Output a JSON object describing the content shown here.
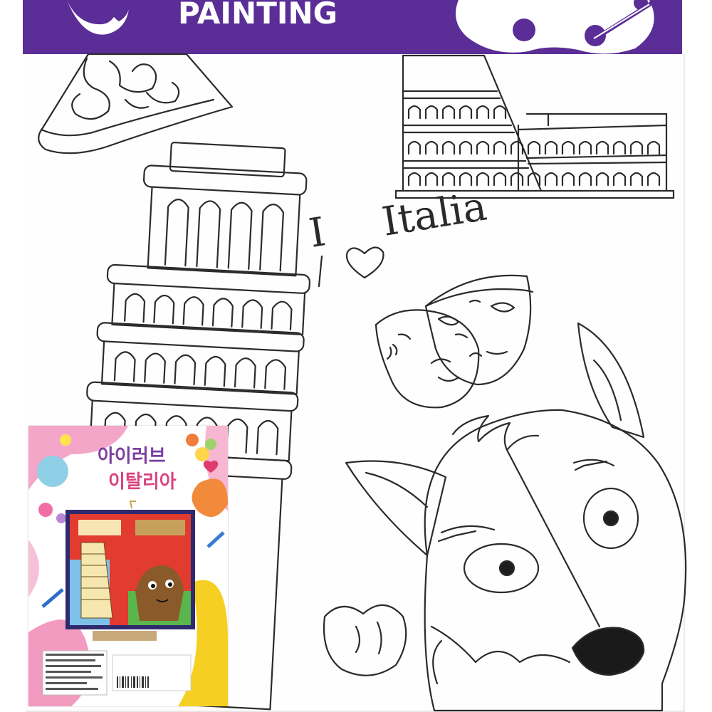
{
  "banner": {
    "title": "PAINTING",
    "color": "#5b2d97"
  },
  "canvas": {
    "slogan_prefix": "I",
    "slogan_suffix": "Italia",
    "icons": [
      "pizza-slice",
      "colosseum",
      "leaning-tower-of-pisa",
      "theater-masks",
      "fox",
      "paint-palette",
      "heart"
    ]
  },
  "package": {
    "title_line1": "아이러브",
    "title_line2": "이탈리아",
    "accent_purple": "#7b3fa0",
    "accent_pink": "#d8447d"
  }
}
